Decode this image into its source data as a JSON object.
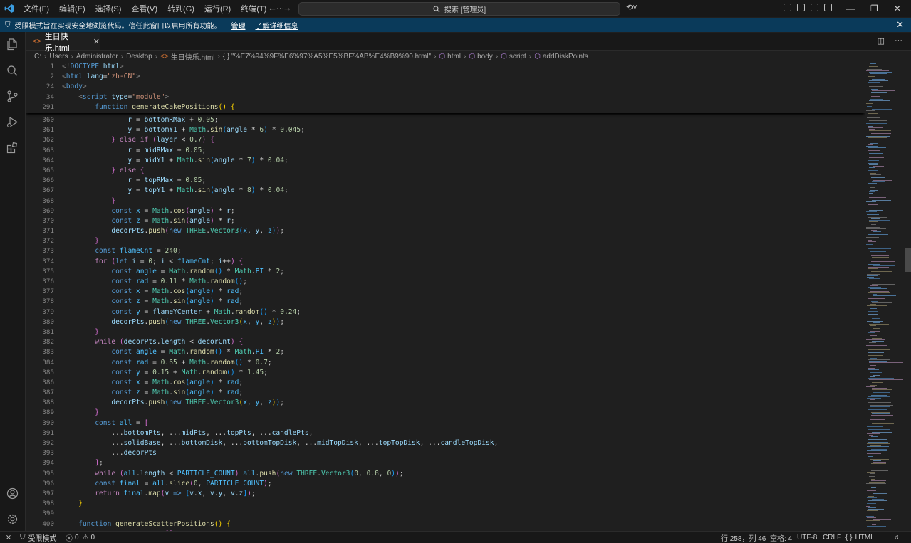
{
  "menu": [
    "文件(F)",
    "编辑(E)",
    "选择(S)",
    "查看(V)",
    "转到(G)",
    "运行(R)",
    "终端(T)",
    "···"
  ],
  "search": {
    "text": "搜索 [管理员]"
  },
  "banner": {
    "message": "受限模式旨在实现安全地浏览代码。信任此窗口以启用所有功能。",
    "manage_link": "管理",
    "learn_more_link": "了解详细信息"
  },
  "tab": {
    "label": "生日快乐.html"
  },
  "breadcrumb": {
    "items": [
      "C:",
      "Users",
      "Administrator",
      "Desktop",
      "生日快乐.html",
      "{ } \"%E7%94%9F%E6%97%A5%E5%BF%AB%E4%B9%90.html\"",
      "html",
      "body",
      "script",
      "addDiskPoints"
    ]
  },
  "sticky_line_numbers": [
    "1",
    "2",
    "24",
    "34",
    "291"
  ],
  "line_numbers": [
    "360",
    "361",
    "362",
    "363",
    "364",
    "365",
    "366",
    "367",
    "368",
    "369",
    "370",
    "371",
    "372",
    "373",
    "374",
    "375",
    "376",
    "377",
    "378",
    "379",
    "380",
    "381",
    "382",
    "383",
    "384",
    "385",
    "386",
    "387",
    "388",
    "389",
    "390",
    "391",
    "392",
    "393",
    "394",
    "395",
    "396",
    "397",
    "398",
    "399",
    "400",
    "401"
  ],
  "status": {
    "restricted_mode": "受限模式",
    "errors": "0",
    "warnings": "0",
    "cursor_position": "行 258，列 46",
    "spaces": "空格: 4",
    "encoding": "UTF-8",
    "eol": "CRLF",
    "language": "HTML"
  },
  "colors": {
    "accent": "#0078d4",
    "banner_bg": "#0a3a5a",
    "editor_bg": "#1f1f1f",
    "chrome_bg": "#181818"
  }
}
